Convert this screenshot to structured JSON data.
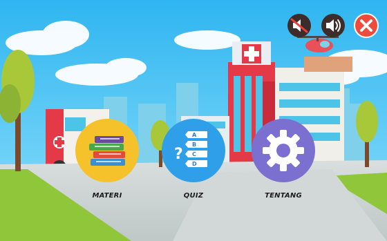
{
  "background": {
    "sky": "#49bff0",
    "ground": "#c9cfcf",
    "grass": "#8fc63a",
    "building": "#e43a48"
  },
  "topbar": {
    "mute": {
      "icon": "speaker-muted-icon",
      "color": "#3d2c2a"
    },
    "sound": {
      "icon": "speaker-on-icon",
      "color": "#3d2c2a"
    },
    "close": {
      "icon": "close-icon",
      "color": "#ef4a3b"
    }
  },
  "menu": {
    "items": [
      {
        "label": "MATERI",
        "icon": "books-icon",
        "color": "#f6c22b"
      },
      {
        "label": "QUIZ",
        "icon": "quiz-options-icon",
        "color": "#2e9fe8"
      },
      {
        "label": "TENTANG",
        "icon": "gear-icon",
        "color": "#7b6fd0"
      }
    ],
    "quiz_options": [
      "A",
      "B",
      "C",
      "D"
    ],
    "quiz_mark": "?"
  }
}
